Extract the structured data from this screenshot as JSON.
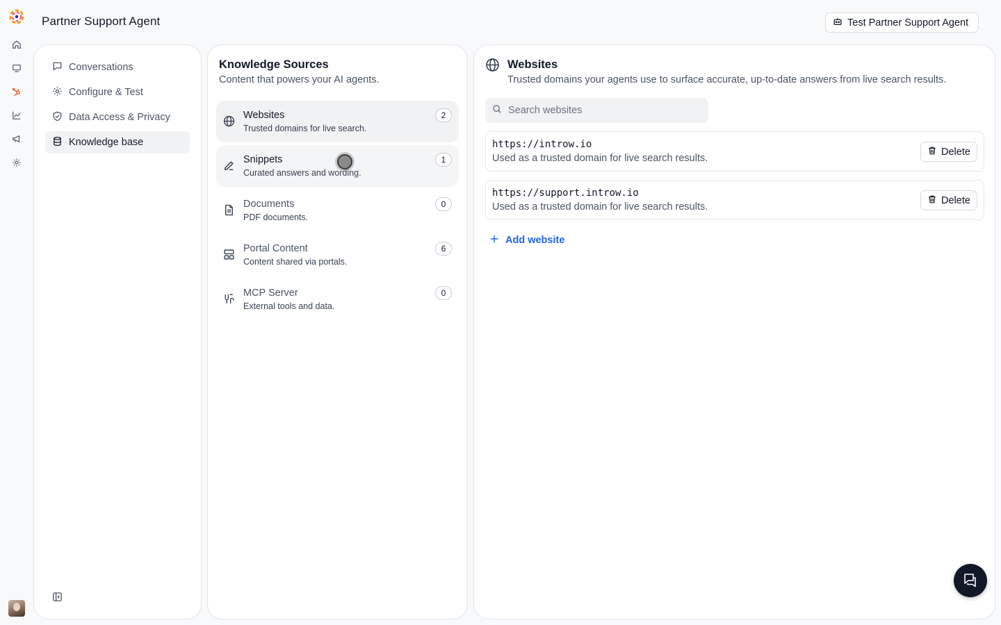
{
  "header": {
    "title": "Partner Support Agent",
    "test_button_label": "Test Partner Support Agent"
  },
  "rail": {
    "icons": [
      "home-icon",
      "monitor-icon",
      "hubspot-icon",
      "chart-icon",
      "megaphone-icon",
      "gear-icon"
    ],
    "active_color": "#ef5a2c"
  },
  "nav": {
    "items": [
      {
        "label": "Conversations",
        "icon": "chat-bubble-icon"
      },
      {
        "label": "Configure & Test",
        "icon": "gear-icon"
      },
      {
        "label": "Data Access & Privacy",
        "icon": "shield-icon"
      },
      {
        "label": "Knowledge base",
        "icon": "database-icon",
        "active": true
      }
    ]
  },
  "knowledge": {
    "title": "Knowledge Sources",
    "subtitle": "Content that powers your AI agents.",
    "sources": [
      {
        "name": "Websites",
        "desc": "Trusted domains for live search.",
        "count": "2",
        "icon": "globe-icon"
      },
      {
        "name": "Snippets",
        "desc": "Curated answers and wording.",
        "count": "1",
        "icon": "pencil-icon"
      },
      {
        "name": "Documents",
        "desc": "PDF documents.",
        "count": "0",
        "icon": "document-icon"
      },
      {
        "name": "Portal Content",
        "desc": "Content shared via portals.",
        "count": "6",
        "icon": "layout-icon"
      },
      {
        "name": "MCP Server",
        "desc": "External tools and data.",
        "count": "0",
        "icon": "plug-icon"
      }
    ]
  },
  "websites": {
    "title": "Websites",
    "subtitle": "Trusted domains your agents use to surface accurate, up-to-date answers from live search results.",
    "search_placeholder": "Search websites",
    "items": [
      {
        "url": "https://introw.io",
        "desc": "Used as a trusted domain for live search results.",
        "delete_label": "Delete"
      },
      {
        "url": "https://support.introw.io",
        "desc": "Used as a trusted domain for live search results.",
        "delete_label": "Delete"
      }
    ],
    "add_label": "Add website",
    "accent": "#2563eb"
  }
}
